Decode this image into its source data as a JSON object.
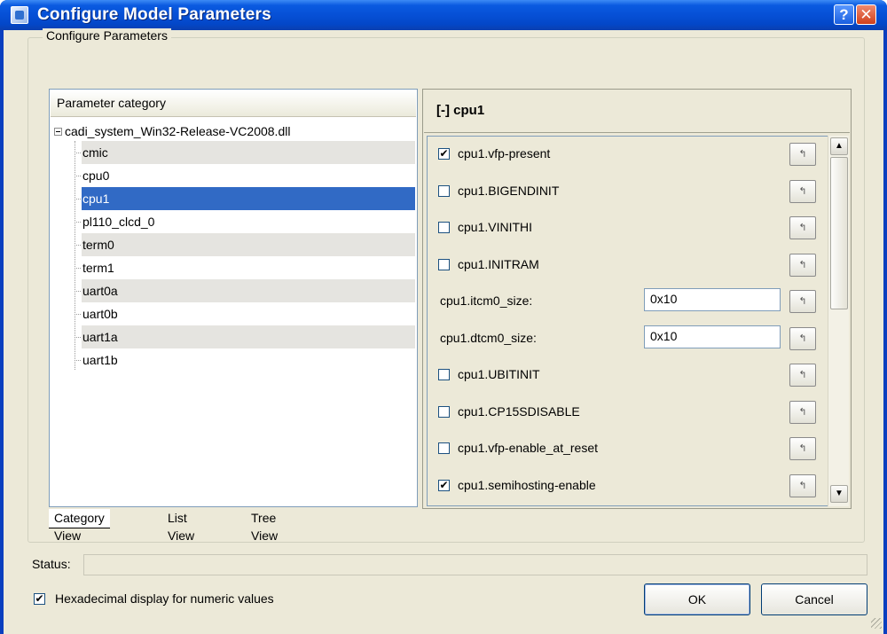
{
  "window": {
    "title": "Configure Model Parameters",
    "help_label": "?",
    "close_label": "✕"
  },
  "group": {
    "title": "Configure Parameters"
  },
  "left": {
    "header": "Parameter category",
    "root": "cadi_system_Win32-Release-VC2008.dll",
    "items": [
      {
        "label": "cmic"
      },
      {
        "label": "cpu0"
      },
      {
        "label": "cpu1"
      },
      {
        "label": "pl110_clcd_0"
      },
      {
        "label": "term0"
      },
      {
        "label": "term1"
      },
      {
        "label": "uart0a"
      },
      {
        "label": "uart0b"
      },
      {
        "label": "uart1a"
      },
      {
        "label": "uart1b"
      }
    ],
    "selected": "cpu1"
  },
  "tabs": [
    {
      "label": "Category View",
      "active": true
    },
    {
      "label": "List View",
      "active": false
    },
    {
      "label": "Tree View",
      "active": false
    }
  ],
  "right": {
    "header": "[-]  cpu1",
    "params": [
      {
        "type": "checkbox",
        "label": "cpu1.vfp-present",
        "checked": true
      },
      {
        "type": "checkbox",
        "label": "cpu1.BIGENDINIT",
        "checked": false
      },
      {
        "type": "checkbox",
        "label": "cpu1.VINITHI",
        "checked": false
      },
      {
        "type": "checkbox",
        "label": "cpu1.INITRAM",
        "checked": false
      },
      {
        "type": "text",
        "label": "cpu1.itcm0_size:",
        "value": "0x10"
      },
      {
        "type": "text",
        "label": "cpu1.dtcm0_size:",
        "value": "0x10"
      },
      {
        "type": "checkbox",
        "label": "cpu1.UBITINIT",
        "checked": false
      },
      {
        "type": "checkbox",
        "label": "cpu1.CP15SDISABLE",
        "checked": false
      },
      {
        "type": "checkbox",
        "label": "cpu1.vfp-enable_at_reset",
        "checked": false
      },
      {
        "type": "checkbox",
        "label": "cpu1.semihosting-enable",
        "checked": true
      }
    ],
    "reset_icon": "reset-default-icon"
  },
  "bottom": {
    "status_label": "Status:",
    "status_value": "",
    "hex_label": "Hexadecimal display for numeric values",
    "hex_checked": true,
    "ok_label": "OK",
    "cancel_label": "Cancel"
  },
  "colors": {
    "titlebar": "#0650d6",
    "selection": "#316ac5",
    "face": "#ece9d8"
  }
}
